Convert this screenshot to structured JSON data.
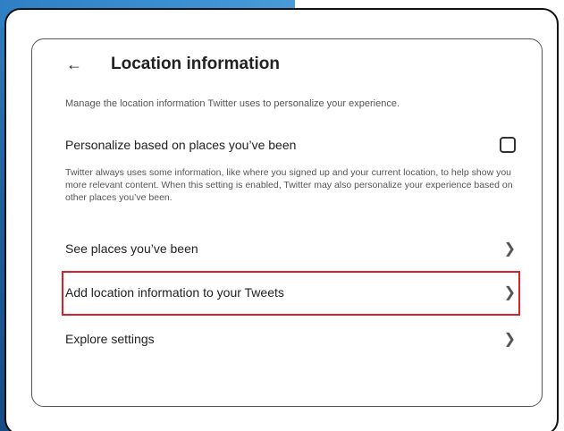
{
  "header": {
    "back_icon": "arrow-left-icon",
    "title": "Location information"
  },
  "description": "Manage the location information Twitter uses to personalize your experience.",
  "personalize": {
    "label": "Personalize based on places you’ve been",
    "checked": false,
    "helper": "Twitter always uses some information, like where you signed up and your current location, to help show you more relevant content. When this setting is enabled, Twitter may also personalize your experience based on other places you’ve been."
  },
  "rows": [
    {
      "label": "See places you’ve been",
      "icon": "chevron-right-icon"
    },
    {
      "label": "Add location information to your Tweets",
      "icon": "chevron-right-icon",
      "highlighted": true
    },
    {
      "label": "Explore settings",
      "icon": "chevron-right-icon"
    }
  ],
  "colors": {
    "highlight": "#d8202c",
    "background_accent": "#2f7fc4"
  }
}
